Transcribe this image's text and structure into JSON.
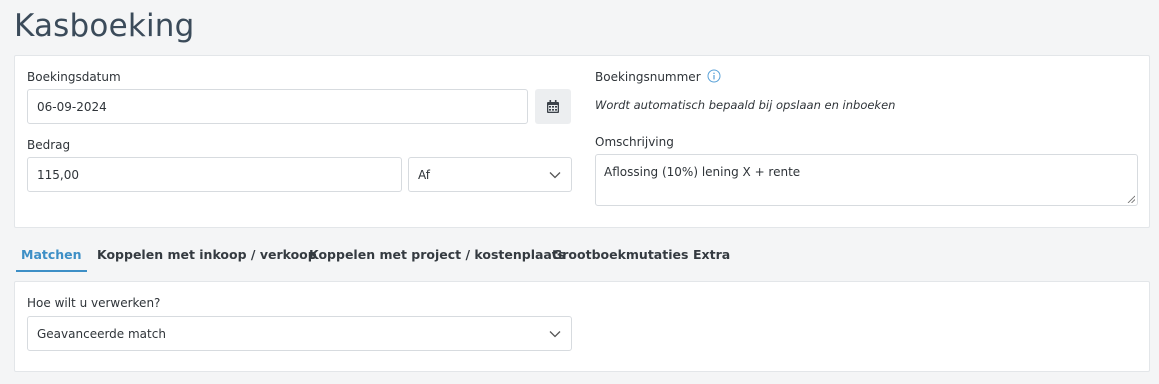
{
  "page": {
    "title": "Kasboeking"
  },
  "form": {
    "date_label": "Boekingsdatum",
    "date_value": "06-09-2024",
    "amount_label": "Bedrag",
    "amount_value": "115,00",
    "direction_value": "Af",
    "number_label": "Boekingsnummer",
    "number_hint": "Wordt automatisch bepaald bij opslaan en inboeken",
    "description_label": "Omschrijving",
    "description_value": "Aflossing (10%) lening X + rente"
  },
  "tabs": [
    {
      "label": "Matchen",
      "active": true
    },
    {
      "label": "Koppelen met inkoop / verkoop",
      "active": false
    },
    {
      "label": "Koppelen met project / kostenplaats",
      "active": false
    },
    {
      "label": "Grootboekmutaties",
      "active": false
    },
    {
      "label": "Extra",
      "active": false
    }
  ],
  "processing": {
    "label": "Hoe wilt u verwerken?",
    "value": "Geavanceerde match"
  },
  "colors": {
    "accent": "#3d8fc6",
    "title": "#3b4b5a",
    "border": "#d7dbdf"
  },
  "icons": {
    "calendar": "calendar-icon",
    "info": "info-icon",
    "dropdown": "chevron-down-icon"
  }
}
